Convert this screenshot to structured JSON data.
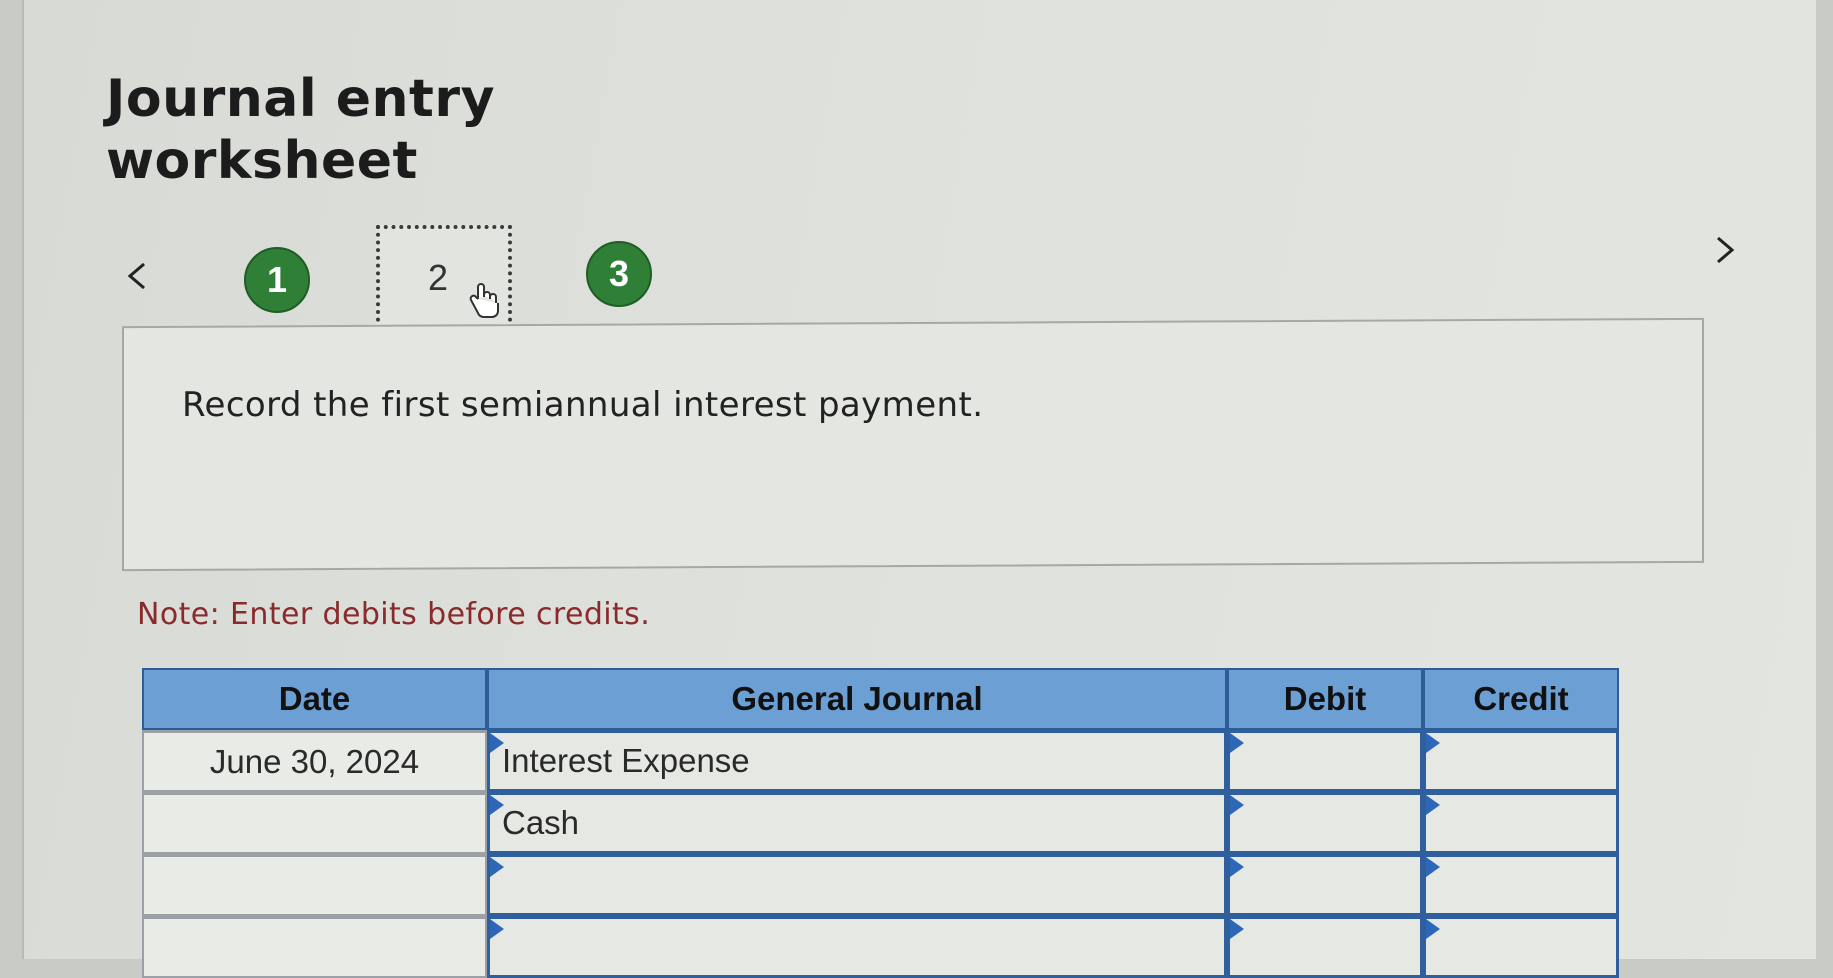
{
  "title_line1": "Journal entry",
  "title_line2": "worksheet",
  "steps": [
    {
      "label": "1",
      "status": "completed"
    },
    {
      "label": "2",
      "status": "current"
    },
    {
      "label": "3",
      "status": "completed"
    }
  ],
  "prompt": "Record the first semiannual interest payment.",
  "note": "Note: Enter debits before credits.",
  "journal": {
    "headers": {
      "date": "Date",
      "general_journal": "General Journal",
      "debit": "Debit",
      "credit": "Credit"
    },
    "rows": [
      {
        "date": "June 30, 2024",
        "account": "Interest Expense",
        "debit": "",
        "credit": ""
      },
      {
        "date": "",
        "account": "Cash",
        "debit": "",
        "credit": ""
      },
      {
        "date": "",
        "account": "",
        "debit": "",
        "credit": ""
      },
      {
        "date": "",
        "account": "",
        "debit": "",
        "credit": ""
      }
    ]
  },
  "icons": {
    "prev": "chevron-left-icon",
    "next": "chevron-right-icon",
    "cursor": "hand-pointer-icon"
  },
  "colors": {
    "step_completed": "#2f7f36",
    "table_header": "#6ca0d4",
    "note_text": "#8a2b2b",
    "cell_border": "#2f5f9c"
  }
}
